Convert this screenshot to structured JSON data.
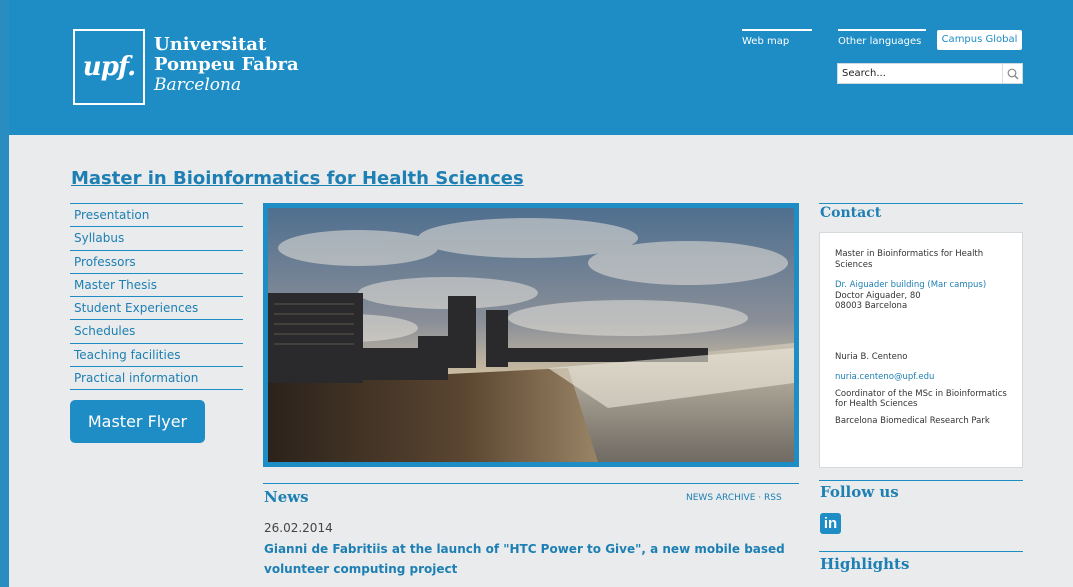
{
  "header": {
    "logo_mark": "upf.",
    "logo_line1": "Universitat",
    "logo_line2": "Pompeu Fabra",
    "logo_line3": "Barcelona",
    "web_map": "Web map",
    "other_languages": "Other languages",
    "campus_global": "Campus Global",
    "search_placeholder": "Search...",
    "search_icon": "magnifier-icon"
  },
  "main": {
    "title": "Master in Bioinformatics for Health Sciences",
    "nav": [
      "Presentation",
      "Syllabus",
      "Professors",
      "Master Thesis",
      "Student Experiences",
      "Schedules",
      "Teaching facilities",
      "Practical information"
    ],
    "flyer_button": "Master Flyer"
  },
  "news": {
    "title": "News",
    "archive_link": "NEWS ARCHIVE",
    "separator": "·",
    "rss_link": "RSS",
    "date": "26.02.2014",
    "headline": "Gianni de Fabritiis at the launch of \"HTC Power to Give\", a new mobile based volunteer computing project"
  },
  "contact": {
    "title": "Contact",
    "program": "Master in Bioinformatics for Health Sciences",
    "building_link": "Dr. Aiguader building (Mar campus)",
    "address1": "Doctor Aiguader, 80",
    "address2": "08003 Barcelona",
    "person": "Nuria B. Centeno",
    "email": "nuria.centeno@upf.edu",
    "role": "Coordinator of the MSc in Bioinformatics for Health Sciences",
    "institution": "Barcelona Biomedical Research Park"
  },
  "follow": {
    "title": "Follow us",
    "linkedin_label": "in",
    "linkedin_icon": "linkedin-icon"
  },
  "highlights": {
    "title": "Highlights"
  },
  "colors": {
    "brand_blue": "#1e8dc5",
    "link_blue": "#1d7fb3",
    "background": "#e9ebec"
  }
}
